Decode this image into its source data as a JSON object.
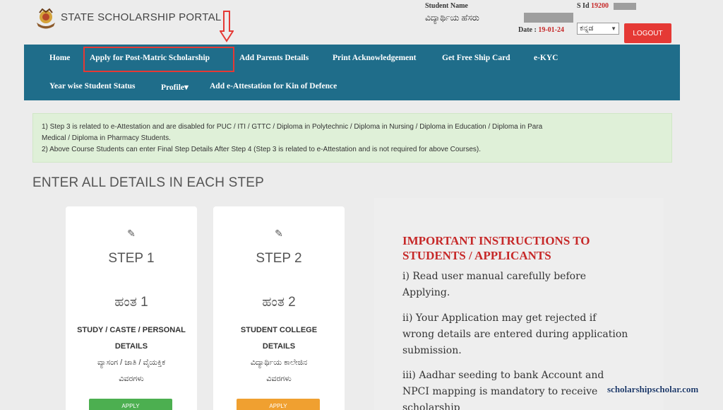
{
  "header": {
    "portal_title": "STATE SCHOLARSHIP PORTAL",
    "student_name_label": "Student Name",
    "student_name_kannada": "ವಿದ್ಯಾರ್ಥಿಯ ಹೆಸರು",
    "sid_label": "S Id",
    "sid_value": "19200",
    "date_label": "Date :",
    "date_value": "19-01-24",
    "language_selected": "ಕನ್ನಡ",
    "logout_label": "LOGOUT"
  },
  "nav": {
    "row1": [
      "Home",
      "Apply for Post-Matric Scholarship",
      "Add Parents Details",
      "Print Acknowledgement",
      "Get Free Ship Card",
      "e-KYC"
    ],
    "row2": [
      "Year wise Student Status",
      "Profile▾",
      "Add e-Attestation for Kin of Defence"
    ]
  },
  "notice": {
    "line1": "1) Step 3 is related to e-Attestation and are disabled for PUC / ITI / GTTC / Diploma in Polytechnic / Diploma in Nursing / Diploma in Education / Diploma in Para",
    "line1b": "Medical / Diploma in Pharmacy Students.",
    "line2": "2) Above Course Students can enter Final Step Details After Step 4 (Step 3 is related to e-Attestation and is not required for above Courses)."
  },
  "section_title": "ENTER ALL DETAILS IN EACH STEP",
  "steps": [
    {
      "title": "STEP 1",
      "title_kn": "ಹಂತ 1",
      "desc": [
        "STUDY / CASTE / PERSONAL",
        "DETAILS"
      ],
      "desc_kn": [
        "ವ್ಯಾಸಂಗ / ಜಾತಿ / ವೈಯಕ್ತಿಕ",
        "ವಿವರಗಳು"
      ],
      "button": "APPLY",
      "button_color": "#4caf50"
    },
    {
      "title": "STEP 2",
      "title_kn": "ಹಂತ 2",
      "desc": [
        "STUDENT COLLEGE",
        "DETAILS"
      ],
      "desc_kn": [
        "ವಿದ್ಯಾರ್ಥಿಯ ಕಾಲೇಜಿನ",
        "ವಿವರಗಳು"
      ],
      "button": "APPLY",
      "button_color": "#f0a030"
    }
  ],
  "instructions": {
    "title_line1": "IMPORTANT INSTRUCTIONS TO",
    "title_line2": "STUDENTS / APPLICANTS",
    "item1": [
      "i) Read user manual carefully before",
      "Applying."
    ],
    "item2": [
      "ii) Your Application may get rejected if",
      "wrong details are entered during application",
      "submission."
    ],
    "item3": [
      "iii) Aadhar seeding to bank Account and",
      "NPCI mapping is mandatory to receive",
      "scholarship"
    ]
  },
  "watermark": "scholarshipscholar.com",
  "colors": {
    "nav_bg": "#1f6d8a",
    "logout": "#e53935",
    "notice_bg": "#dff0d8",
    "instruction_title": "#c62828",
    "highlight": "#e53935"
  }
}
